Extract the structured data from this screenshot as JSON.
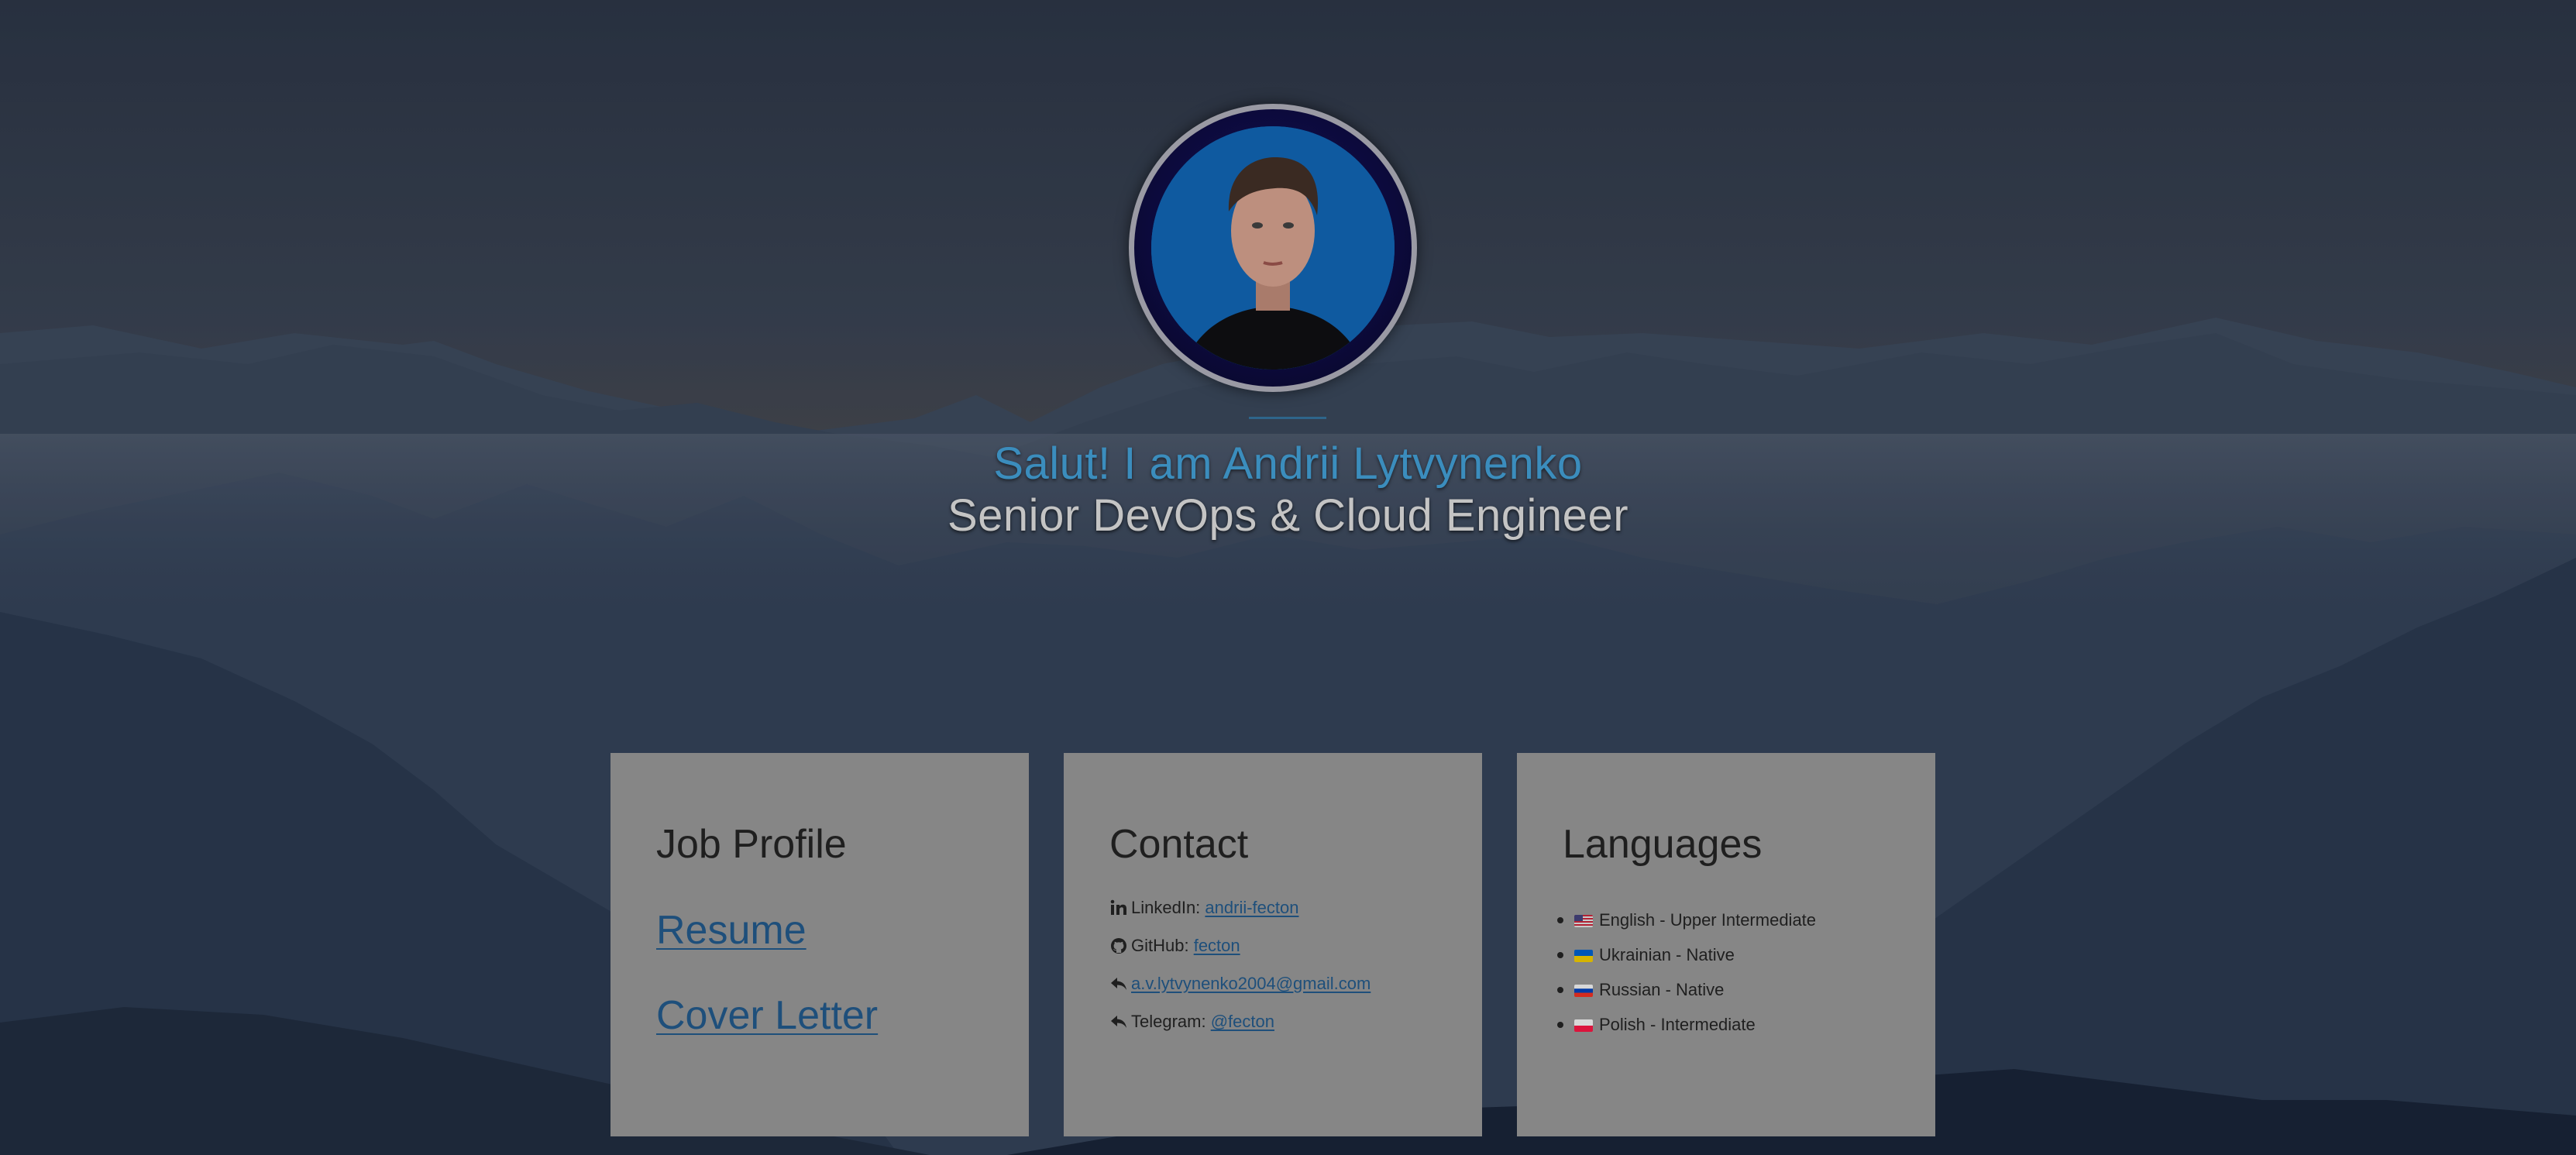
{
  "header": {
    "greeting": "Salut! I am Andrii Lytvynenko",
    "role": "Senior DevOps & Cloud Engineer"
  },
  "cards": {
    "job": {
      "title": "Job Profile",
      "links": [
        "Resume",
        "Cover Letter"
      ]
    },
    "contact": {
      "title": "Contact",
      "items": [
        {
          "label": "LinkedIn: ",
          "value": "andrii-fecton",
          "icon": "linkedin-icon"
        },
        {
          "label": "GitHub: ",
          "value": "fecton",
          "icon": "github-icon"
        },
        {
          "label": "",
          "value": "a.v.lytvynenko2004@gmail.com",
          "icon": "reply-icon"
        },
        {
          "label": "Telegram: ",
          "value": "@fecton",
          "icon": "reply-icon"
        }
      ]
    },
    "languages": {
      "title": "Languages",
      "items": [
        {
          "text": "English - Upper Intermediate",
          "flag": "us-flag"
        },
        {
          "text": "Ukrainian - Native",
          "flag": "ua-flag"
        },
        {
          "text": "Russian - Native",
          "flag": "ru-flag"
        },
        {
          "text": "Polish - Intermediate",
          "flag": "pl-flag"
        }
      ]
    }
  },
  "colors": {
    "greeting": "#3b8dbd",
    "role": "#c4c4c4",
    "card_bg": "#868686",
    "link": "#1e4f7b",
    "avatar_bg": "#0f5aa0"
  }
}
